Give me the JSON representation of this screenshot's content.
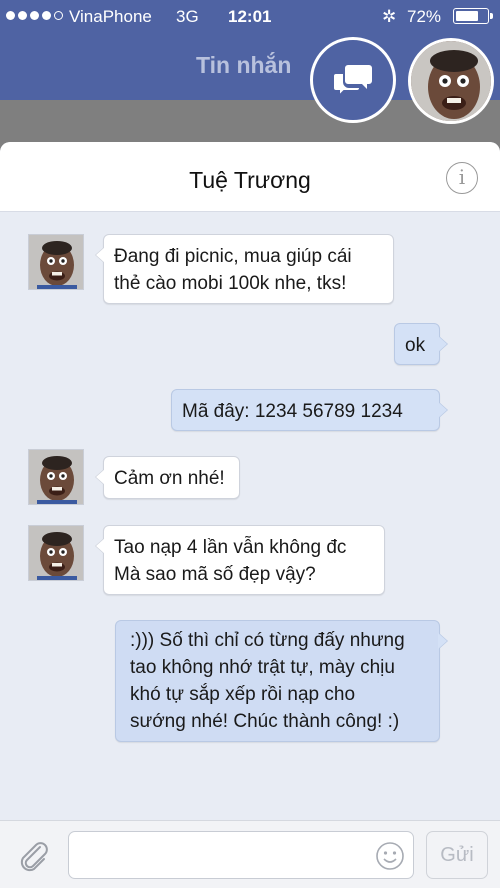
{
  "status_bar": {
    "carrier": "VinaPhone",
    "network": "3G",
    "time": "12:01",
    "battery": "72%",
    "battery_level": 0.72
  },
  "header": {
    "title": "Tin nhắn",
    "compose_icon": "chat-bubbles-icon",
    "avatar_icon": "user-avatar"
  },
  "conversation": {
    "contact_name": "Tuệ Trương",
    "info_icon": "info-icon",
    "messages": [
      {
        "direction": "in",
        "lines": [
          "Đang đi picnic, mua giúp cái",
          "thẻ cào mobi 100k nhe, tks!"
        ]
      },
      {
        "direction": "out",
        "lines": [
          "ok"
        ]
      },
      {
        "direction": "out",
        "lines": [
          "Mã đây: 1234 56789 1234"
        ]
      },
      {
        "direction": "in",
        "lines": [
          "Cảm ơn nhé!"
        ]
      },
      {
        "direction": "in",
        "lines": [
          "Tao nạp 4 lần vẫn không đc",
          "Mà sao mã số đẹp vậy?"
        ]
      },
      {
        "direction": "out",
        "lines": [
          ":))) Số thì chỉ có từng đấy nhưng",
          "tao không nhớ trật tự, mày chịu",
          "khó tự sắp xếp rồi nạp cho",
          "sướng nhé! Chúc thành công! :)"
        ]
      }
    ]
  },
  "composer": {
    "input_value": "",
    "attach_icon": "paperclip-icon",
    "emoji_icon": "smiley-icon",
    "send_label": "Gửi"
  },
  "colors": {
    "header_blue": "#4f63a3",
    "chat_background": "#e8ecf4",
    "outgoing_bubble": "#d4e1f6",
    "incoming_bubble": "#ffffff"
  }
}
